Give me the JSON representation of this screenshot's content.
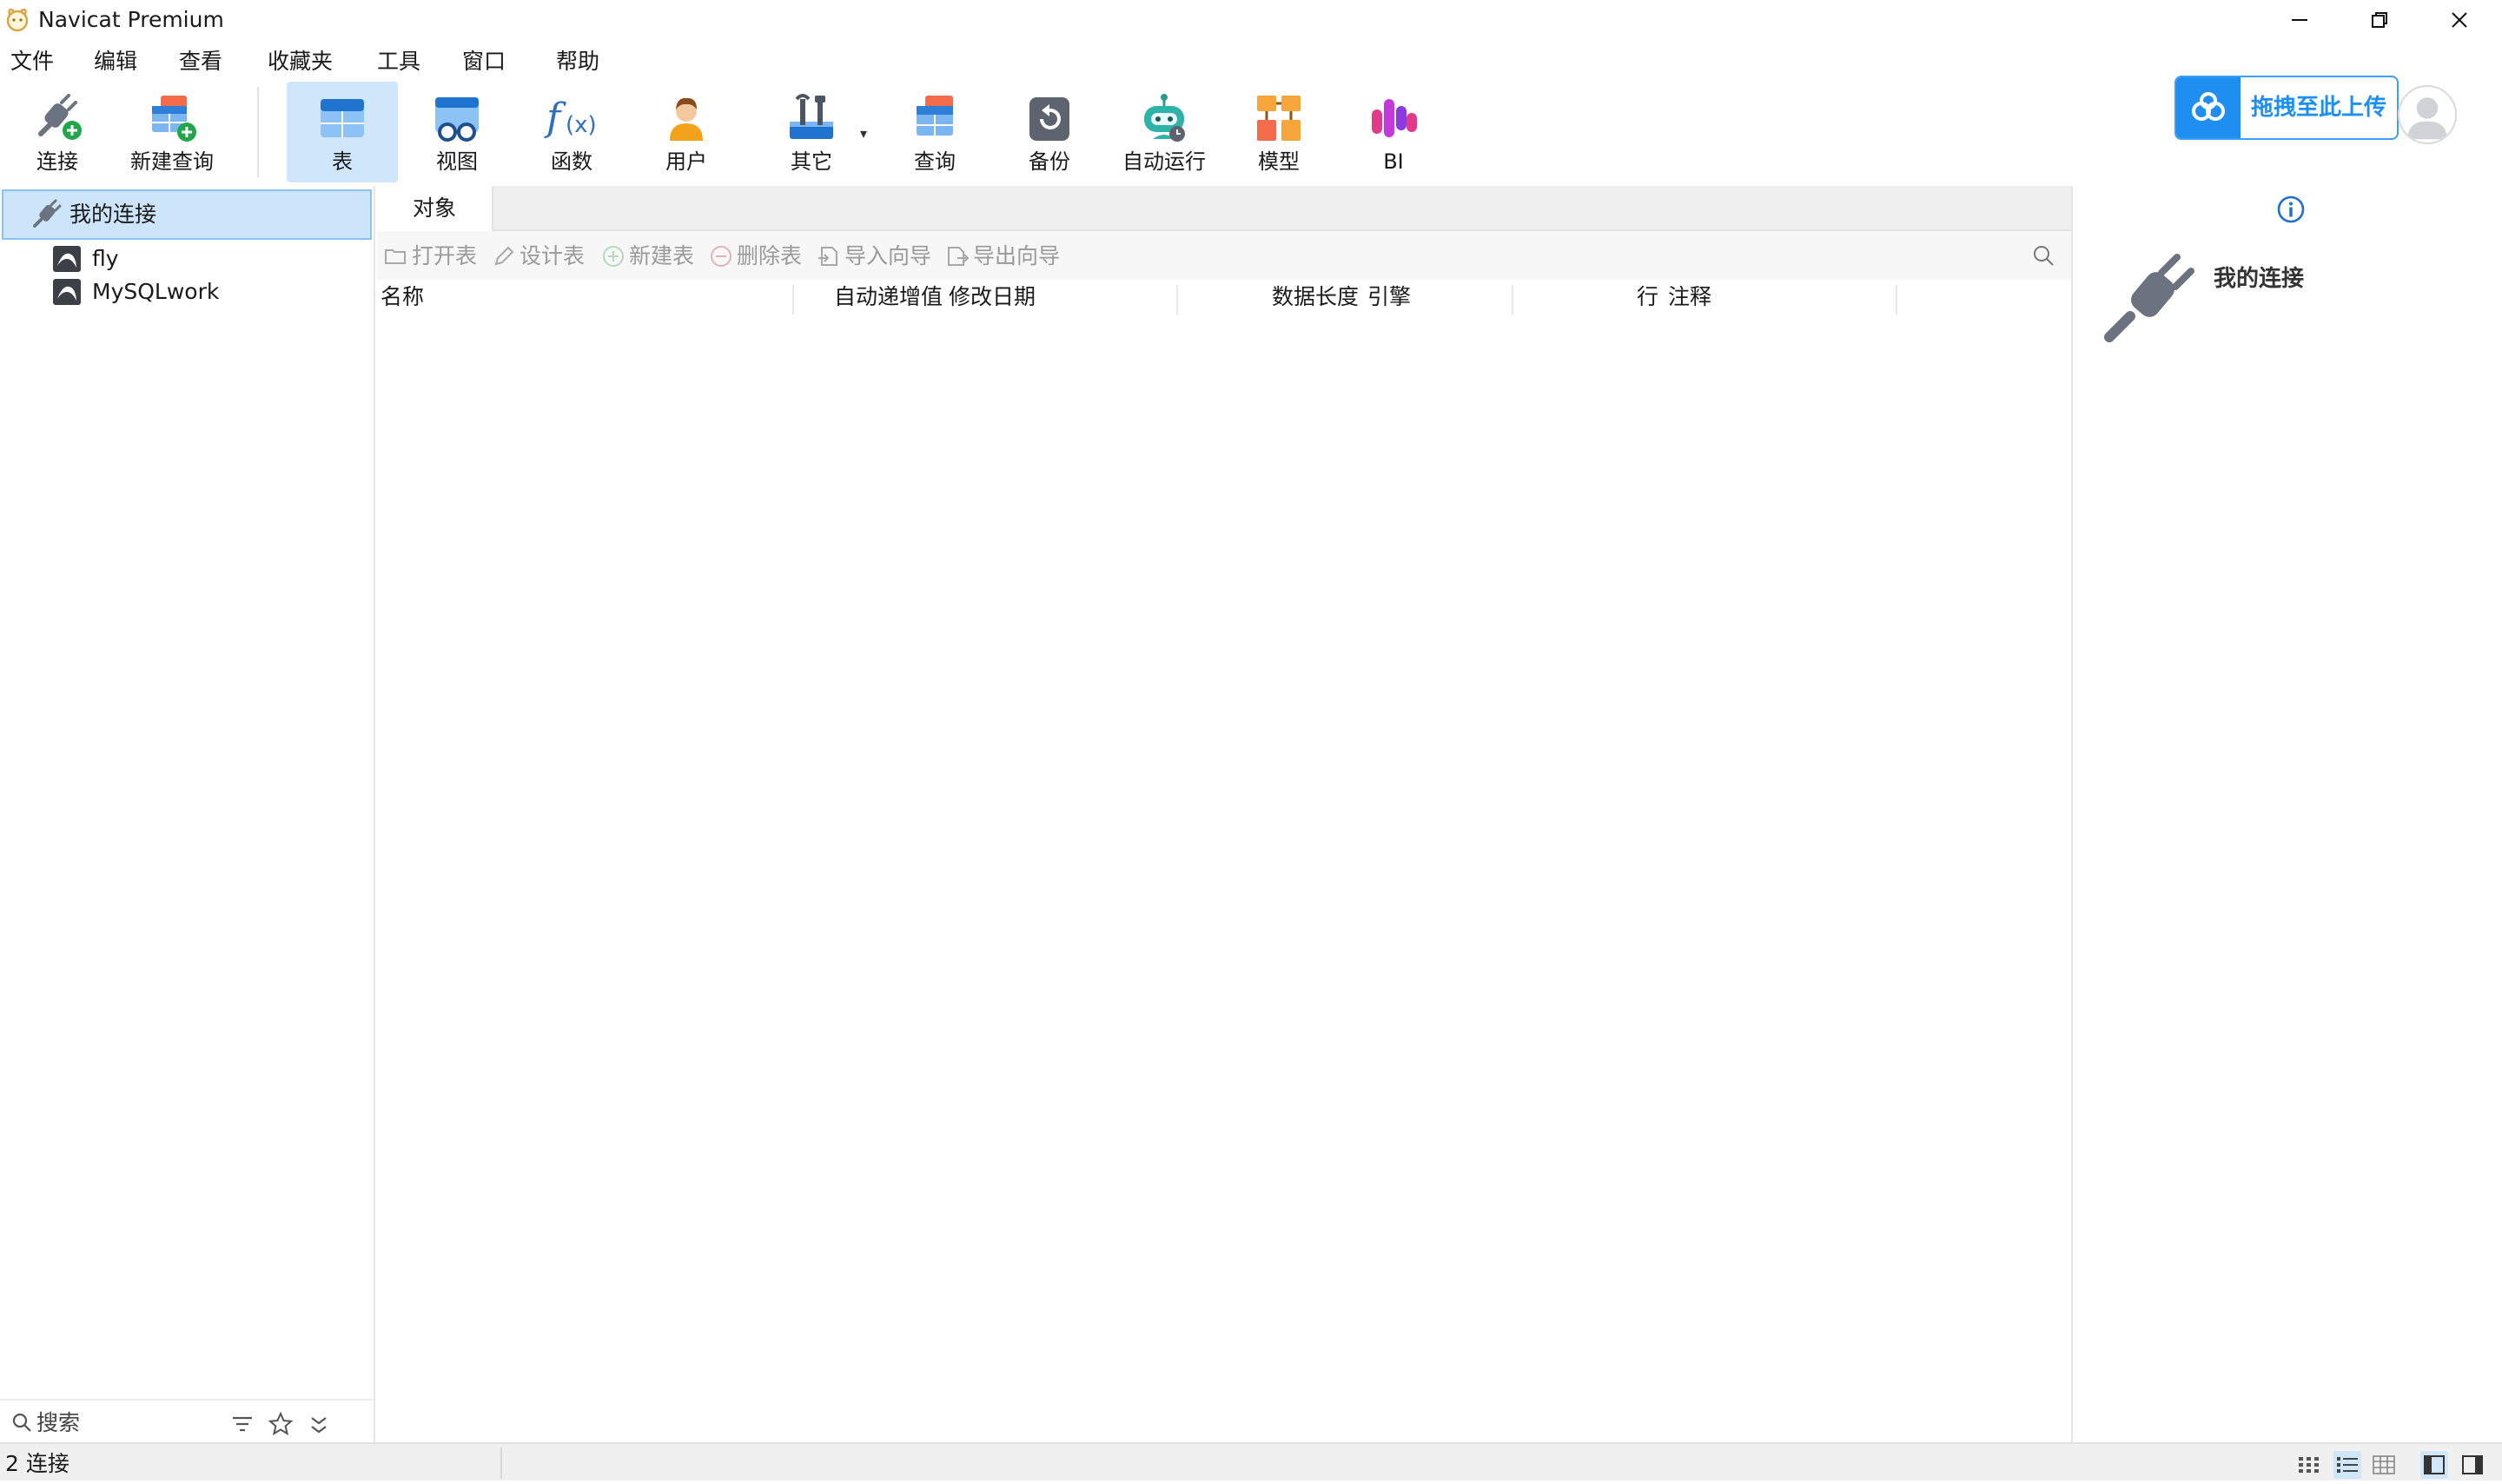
{
  "window": {
    "title": "Navicat Premium"
  },
  "menu": [
    "文件",
    "编辑",
    "查看",
    "收藏夹",
    "工具",
    "窗口",
    "帮助"
  ],
  "toolbar": {
    "connect": "连接",
    "new_query": "新建查询",
    "table": "表",
    "view": "视图",
    "function": "函数",
    "user": "用户",
    "other": "其它",
    "query": "查询",
    "backup": "备份",
    "automation": "自动运行",
    "model": "模型",
    "bi": "BI",
    "upload": "拖拽至此上传"
  },
  "tree": {
    "root": "我的连接",
    "connections": [
      "fly",
      "MySQLwork"
    ]
  },
  "left_search": {
    "placeholder": "搜索"
  },
  "tabs": [
    "对象"
  ],
  "actions": {
    "open_table": "打开表",
    "design_table": "设计表",
    "new_table": "新建表",
    "delete_table": "删除表",
    "import_wizard": "导入向导",
    "export_wizard": "导出向导"
  },
  "columns": {
    "name": "名称",
    "auto_inc": "自动递增值",
    "modified": "修改日期",
    "data_length": "数据长度",
    "engine": "引擎",
    "rows": "行",
    "comment": "注释"
  },
  "right_panel": {
    "title": "我的连接"
  },
  "status": {
    "text": "2 连接"
  },
  "colors": {
    "accent": "#1e8ff0",
    "selection": "#cde5fb"
  }
}
